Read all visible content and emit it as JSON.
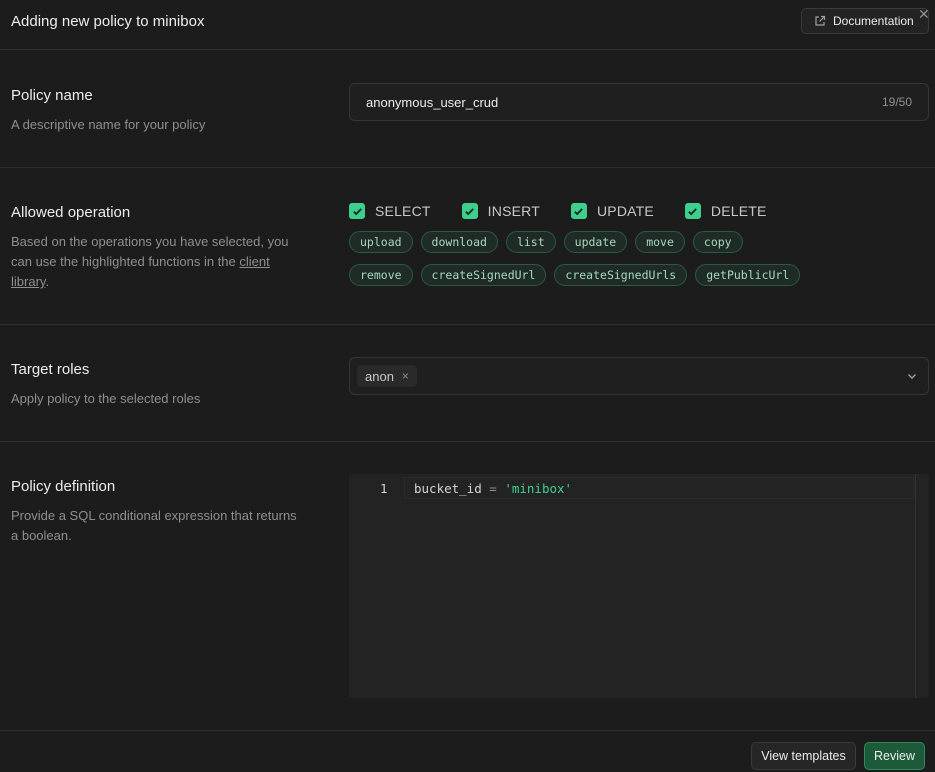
{
  "header": {
    "title": "Adding new policy to minibox",
    "documentation_label": "Documentation",
    "close_label": "✕"
  },
  "policy_name": {
    "title": "Policy name",
    "description": "A descriptive name for your policy",
    "value": "anonymous_user_crud",
    "char_count": "19/50"
  },
  "allowed_operation": {
    "title": "Allowed operation",
    "description_prefix": "Based on the operations you have selected, you can use the highlighted functions in the ",
    "description_link": "client library",
    "description_suffix": ".",
    "operations": [
      {
        "label": "SELECT",
        "checked": true
      },
      {
        "label": "INSERT",
        "checked": true
      },
      {
        "label": "UPDATE",
        "checked": true
      },
      {
        "label": "DELETE",
        "checked": true
      }
    ],
    "functions_row1": [
      "upload",
      "download",
      "list",
      "update",
      "move",
      "copy"
    ],
    "functions_row2": [
      "remove",
      "createSignedUrl",
      "createSignedUrls",
      "getPublicUrl"
    ]
  },
  "target_roles": {
    "title": "Target roles",
    "description": "Apply policy to the selected roles",
    "selected": [
      "anon"
    ],
    "remove_label": "×"
  },
  "policy_definition": {
    "title": "Policy definition",
    "description": "Provide a SQL conditional expression that returns a boolean.",
    "line_number": "1",
    "code_identifier": "bucket_id",
    "code_operator": "=",
    "code_string": "'minibox'"
  },
  "footer": {
    "templates_label": "View templates",
    "review_label": "Review"
  },
  "colors": {
    "accent": "#3ecf8e",
    "background": "#1c1c1c",
    "review_button": "#1d5a3a"
  }
}
